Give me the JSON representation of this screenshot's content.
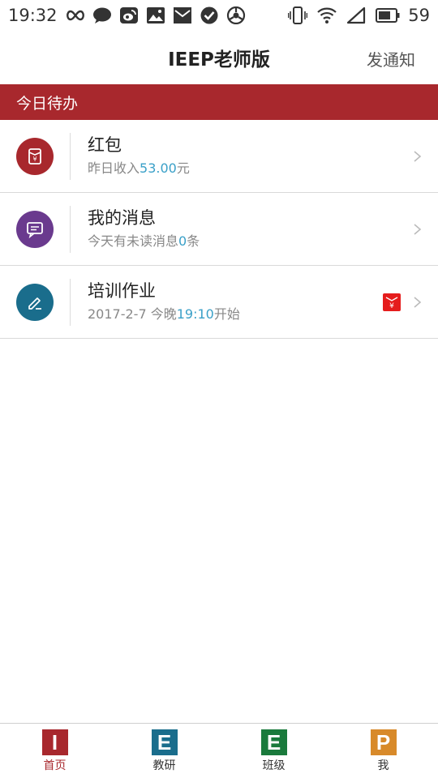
{
  "status_bar": {
    "time": "19:32",
    "battery_level": "59",
    "left_icons": [
      "infinity-icon",
      "chat-bubble-icon",
      "weibo-icon",
      "image-icon",
      "mail-icon",
      "check-circle-icon",
      "sync-icon"
    ],
    "right_icons": [
      "vibrate-icon",
      "wifi-icon",
      "signal-icon",
      "battery-icon"
    ]
  },
  "header": {
    "title": "IEEP老师版",
    "notify_label": "发通知"
  },
  "section": {
    "title": "今日待办"
  },
  "items": [
    {
      "title": "红包",
      "sub_prefix": "昨日收入",
      "sub_highlight": "53.00",
      "sub_suffix": "元",
      "icon": "red-envelope-icon",
      "color": "#a8282d"
    },
    {
      "title": "我的消息",
      "sub_prefix": "今天有未读消息",
      "sub_highlight": "0",
      "sub_suffix": "条",
      "icon": "message-icon",
      "color": "#6a3a8e"
    },
    {
      "title": "培训作业",
      "sub_prefix": "2017-2-7 今晚",
      "sub_highlight": "19:10",
      "sub_suffix": "开始",
      "icon": "edit-pencil-icon",
      "color": "#1a6d8c",
      "badge": "¥"
    }
  ],
  "colors": {
    "accent": "#a8282d",
    "highlight": "#3aa0c8"
  },
  "nav": [
    {
      "letter": "I",
      "label": "首页",
      "color": "#a8282d",
      "active": true
    },
    {
      "letter": "E",
      "label": "教研",
      "color": "#1a6d8c",
      "active": false
    },
    {
      "letter": "E",
      "label": "班级",
      "color": "#1a7a3c",
      "active": false
    },
    {
      "letter": "P",
      "label": "我",
      "color": "#d88a2a",
      "active": false
    }
  ]
}
